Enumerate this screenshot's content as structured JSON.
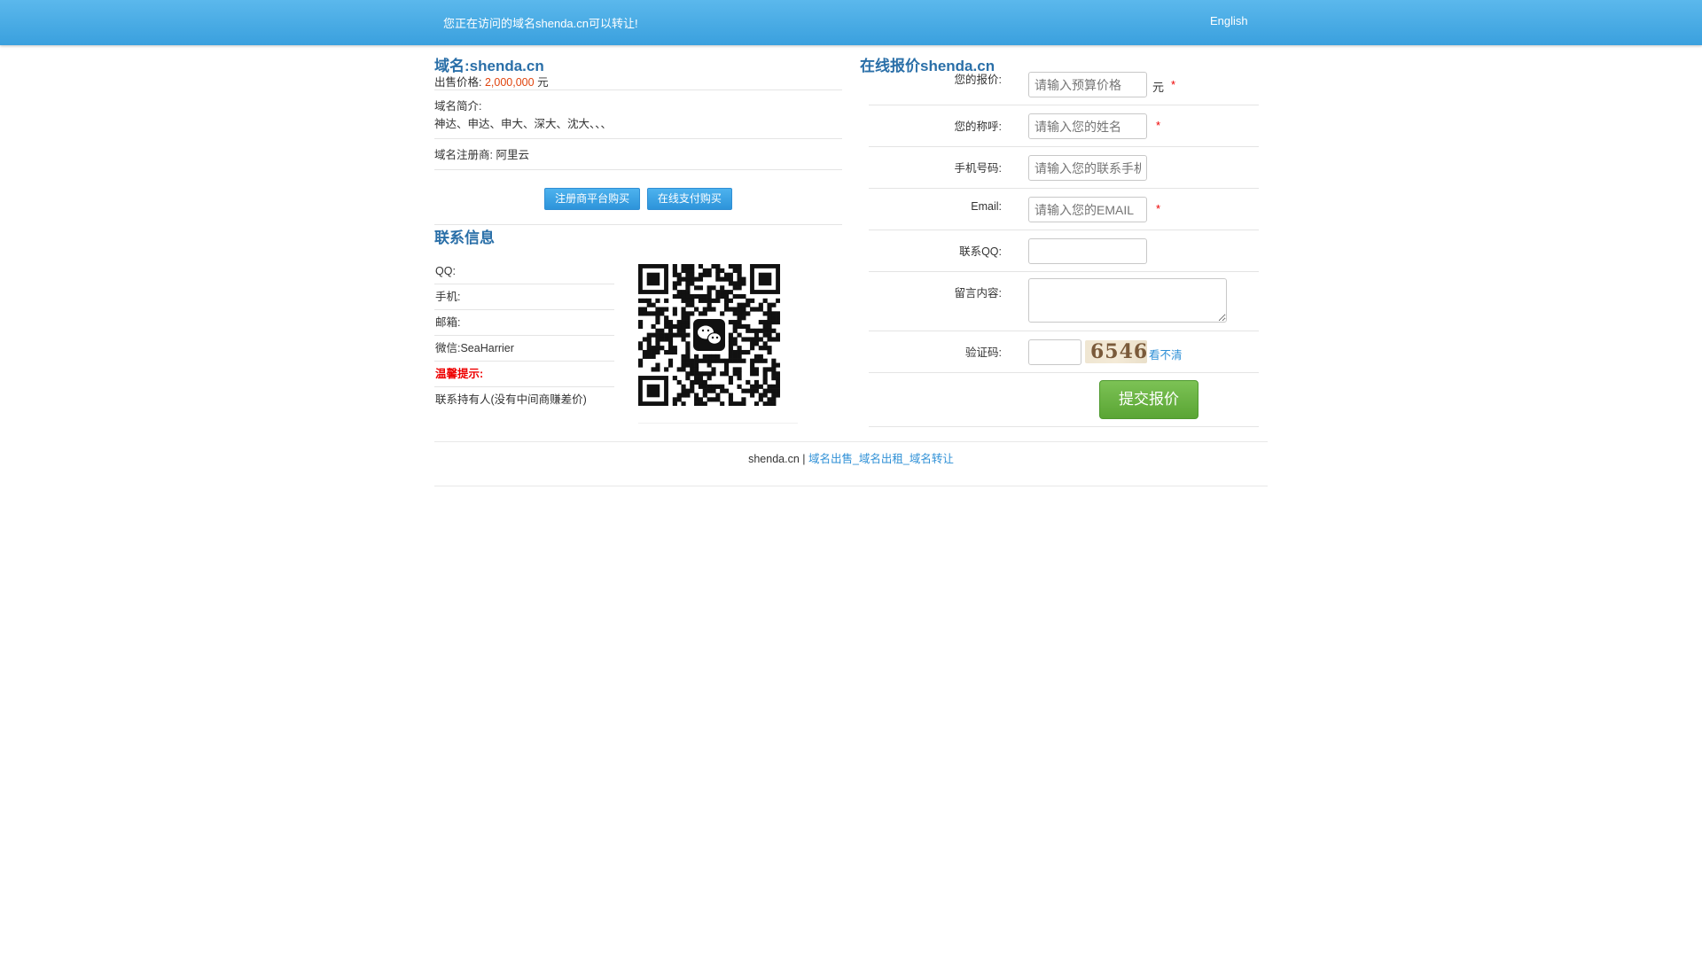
{
  "topbar": {
    "notice": "您正在访问的域名shenda.cn可以转让!",
    "language": "English"
  },
  "domain": {
    "title": "域名:shenda.cn",
    "price_label": "出售价格:",
    "price_value": "2,000,000",
    "price_unit": "元",
    "intro_label": "域名简介:",
    "intro_text": "神达、申达、申大、深大、沈大、、、",
    "registrar": "域名注册商: 阿里云"
  },
  "buy_buttons": {
    "registrar_buy": "注册商平台购买",
    "online_pay": "在线支付购买"
  },
  "contact": {
    "title": "联系信息",
    "items": [
      {
        "label": "QQ:"
      },
      {
        "label": "手机:"
      },
      {
        "label": "邮箱:"
      },
      {
        "label": "微信:SeaHarrier"
      },
      {
        "label": "温馨提示:"
      },
      {
        "label": "联系持有人(没有中间商赚差价)"
      }
    ],
    "qr_icon": "wechat-icon"
  },
  "offer_form": {
    "title": "在线报价shenda.cn",
    "price": {
      "label": "您的报价:",
      "placeholder": "请输入预算价格",
      "unit": "元",
      "required": "*"
    },
    "name": {
      "label": "您的称呼:",
      "placeholder": "请输入您的姓名",
      "required": "*"
    },
    "phone": {
      "label": "手机号码:",
      "placeholder": "请输入您的联系手机"
    },
    "email": {
      "label": "Email:",
      "placeholder": "请输入您的EMAIL",
      "required": "*"
    },
    "qq": {
      "label": "联系QQ:",
      "placeholder": ""
    },
    "message": {
      "label": "留言内容:",
      "placeholder": ""
    },
    "captcha": {
      "label": "验证码:",
      "image_text": "6546",
      "refresh": "看不清"
    },
    "submit": "提交报价"
  },
  "footer": {
    "site": "shenda.cn |",
    "link": "域名出售_域名出租_域名转让"
  },
  "colors": {
    "topbar": "#3aa0de",
    "title_blue": "#2a6fa8",
    "price_red": "#e0440e",
    "submit_green": "#5aa534"
  }
}
